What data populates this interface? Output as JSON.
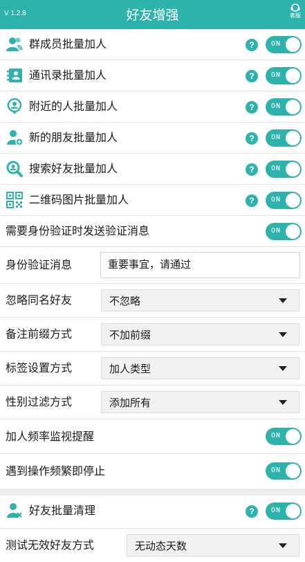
{
  "header": {
    "version": "V 1.2.8",
    "title": "好友增强",
    "service_label": "客服"
  },
  "toggle_text": "ON",
  "help_glyph": "?",
  "features": [
    {
      "label": "群成员批量加人",
      "icon": "group-members-icon"
    },
    {
      "label": "通讯录批量加人",
      "icon": "contacts-book-icon"
    },
    {
      "label": "附近的人批量加人",
      "icon": "nearby-people-icon"
    },
    {
      "label": "新的朋友批量加人",
      "icon": "new-friend-icon"
    },
    {
      "label": "搜索好友批量加人",
      "icon": "search-friend-icon"
    },
    {
      "label": "二维码图片批量加人",
      "icon": "qr-code-icon"
    }
  ],
  "verify_send": {
    "label": "需要身份验证时发送验证消息"
  },
  "verify_message": {
    "label": "身份验证消息",
    "value": "重要事宜，请通过"
  },
  "selects": [
    {
      "label": "忽略同名好友",
      "value": "不忽略"
    },
    {
      "label": "备注前缀方式",
      "value": "不加前缀"
    },
    {
      "label": "标签设置方式",
      "value": "加人类型"
    },
    {
      "label": "性别过滤方式",
      "value": "添加所有"
    }
  ],
  "frequency_monitor": {
    "label": "加人频率监视提醒"
  },
  "stop_on_frequent": {
    "label": "遇到操作频繁即停止"
  },
  "cleanup": {
    "label": "好友批量清理",
    "icon": "friend-cleanup-icon"
  },
  "test_invalid": {
    "label": "测试无效好友方式",
    "value": "无动态天数"
  },
  "colors": {
    "accent": "#2eb3ac"
  }
}
